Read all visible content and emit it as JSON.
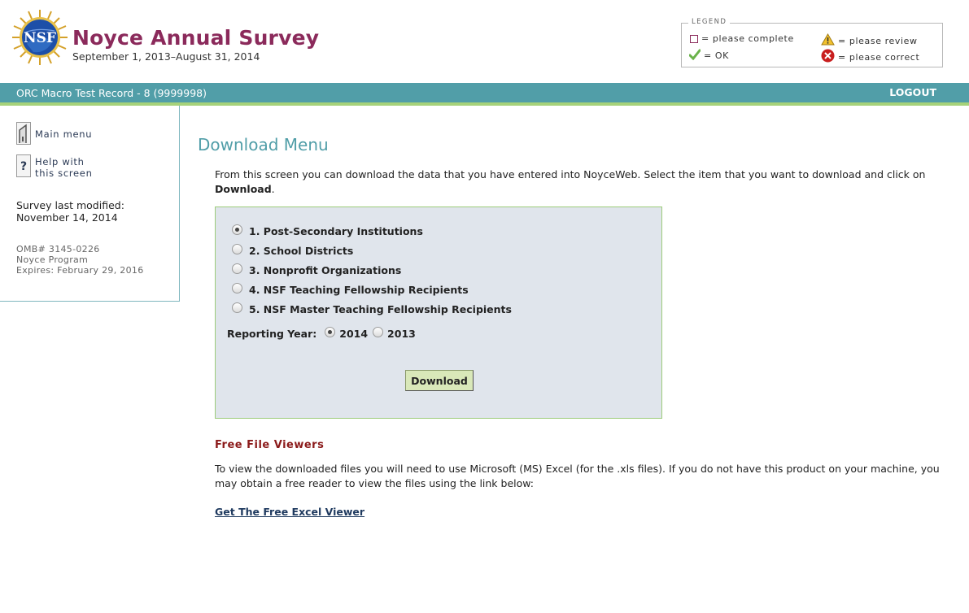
{
  "header": {
    "logo_text": "NSF",
    "title": "Noyce Annual Survey",
    "subtitle": "September 1, 2013–August 31, 2014"
  },
  "legend": {
    "title": "LEGEND",
    "complete": "= please complete",
    "review": "= please review",
    "ok": "= OK",
    "correct": "= please correct"
  },
  "topbar": {
    "record": "ORC Macro Test Record - 8 (9999998)",
    "logout": "LOGOUT"
  },
  "sidebar": {
    "main_menu": "Main menu",
    "help_line1": "Help with",
    "help_line2": "this screen",
    "modified_label": "Survey last modified:",
    "modified_date": "November 14, 2014",
    "omb": "OMB# 3145-0226",
    "program": "Noyce Program",
    "expires": "Expires: February 29, 2016"
  },
  "main": {
    "page_title": "Download Menu",
    "intro_text": "From this screen you can download the data that you have entered into NoyceWeb. Select the item that you want to download and click on ",
    "intro_bold": "Download",
    "intro_end": ".",
    "options": [
      "1. Post-Secondary Institutions",
      "2. School Districts",
      "3. Nonprofit Organizations",
      "4. NSF Teaching Fellowship Recipients",
      "5. NSF Master Teaching Fellowship Recipients"
    ],
    "selected_option": 0,
    "year_label": "Reporting Year:",
    "years": [
      "2014",
      "2013"
    ],
    "selected_year": "2014",
    "download_label": "Download",
    "viewers_title": "Free File Viewers",
    "viewers_text": "To view the downloaded files you will need to use Microsoft (MS) Excel (for the .xls files). If you do not have this product on your machine, you may obtain a free reader to view the files using the link below:",
    "excel_link": "Get The Free Excel Viewer"
  },
  "colors": {
    "brand": "#8b2a5b",
    "teal": "#519ea8",
    "green_line": "#a6d27a",
    "panel_bg": "#e0e5ec",
    "panel_border": "#9ccc7a",
    "viewers_title": "#8b1a1a"
  }
}
